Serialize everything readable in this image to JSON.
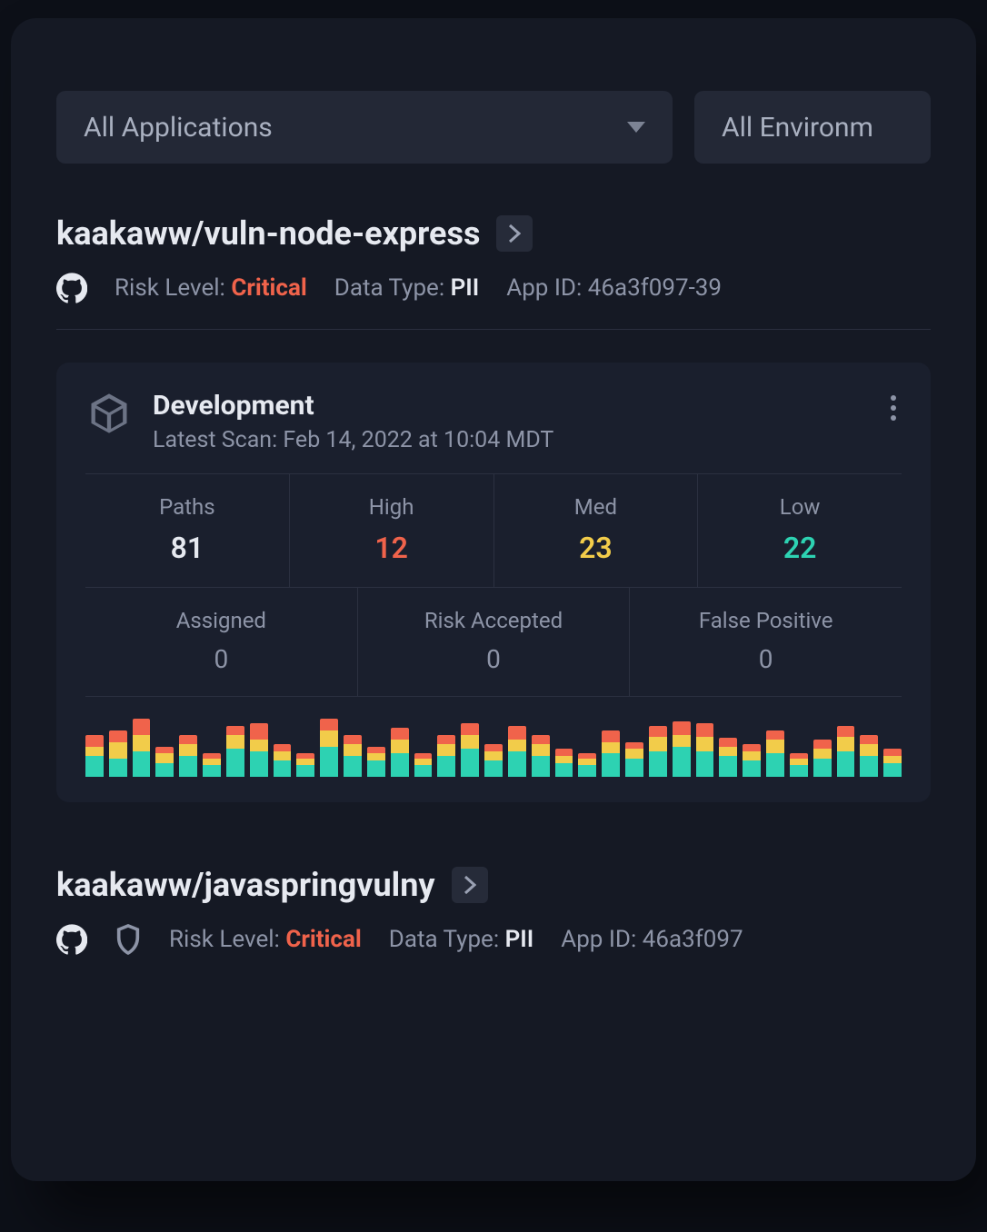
{
  "filters": {
    "applications_label": "All Applications",
    "environments_label": "All Environm"
  },
  "apps": [
    {
      "name": "kaakaww/vuln-node-express",
      "risk_label": "Risk Level:",
      "risk_value": "Critical",
      "data_label": "Data Type:",
      "data_value": "PII",
      "appid_label": "App ID:",
      "appid_value": "46a3f097-39",
      "env": {
        "name": "Development",
        "scan_label": "Latest Scan: Feb 14, 2022 at 10:04 MDT",
        "stats": {
          "paths_label": "Paths",
          "paths": "81",
          "high_label": "High",
          "high": "12",
          "med_label": "Med",
          "med": "23",
          "low_label": "Low",
          "low": "22",
          "assigned_label": "Assigned",
          "assigned": "0",
          "risk_accepted_label": "Risk Accepted",
          "risk_accepted": "0",
          "false_positive_label": "False Positive",
          "false_positive": "0"
        }
      }
    },
    {
      "name": "kaakaww/javaspringvulny",
      "risk_label": "Risk Level:",
      "risk_value": "Critical",
      "data_label": "Data Type:",
      "data_value": "PII",
      "appid_label": "App ID:",
      "appid_value": "46a3f097"
    }
  ],
  "colors": {
    "critical": "#f0634b",
    "high": "#f0634b",
    "med": "#f2cc4a",
    "low": "#2dd2b2"
  },
  "chart_data": {
    "type": "bar",
    "title": "",
    "xlabel": "",
    "ylabel": "",
    "series_names": [
      "low",
      "med",
      "high"
    ],
    "bars": [
      {
        "low": 18,
        "med": 8,
        "high": 10
      },
      {
        "low": 16,
        "med": 14,
        "high": 10
      },
      {
        "low": 22,
        "med": 14,
        "high": 14
      },
      {
        "low": 12,
        "med": 8,
        "high": 6
      },
      {
        "low": 18,
        "med": 10,
        "high": 8
      },
      {
        "low": 10,
        "med": 6,
        "high": 4
      },
      {
        "low": 24,
        "med": 12,
        "high": 8
      },
      {
        "low": 22,
        "med": 10,
        "high": 14
      },
      {
        "low": 14,
        "med": 8,
        "high": 6
      },
      {
        "low": 10,
        "med": 6,
        "high": 4
      },
      {
        "low": 26,
        "med": 14,
        "high": 10
      },
      {
        "low": 18,
        "med": 10,
        "high": 8
      },
      {
        "low": 14,
        "med": 6,
        "high": 6
      },
      {
        "low": 20,
        "med": 12,
        "high": 10
      },
      {
        "low": 10,
        "med": 6,
        "high": 4
      },
      {
        "low": 18,
        "med": 10,
        "high": 8
      },
      {
        "low": 24,
        "med": 12,
        "high": 10
      },
      {
        "low": 14,
        "med": 8,
        "high": 6
      },
      {
        "low": 22,
        "med": 10,
        "high": 12
      },
      {
        "low": 18,
        "med": 10,
        "high": 8
      },
      {
        "low": 12,
        "med": 6,
        "high": 6
      },
      {
        "low": 10,
        "med": 6,
        "high": 4
      },
      {
        "low": 20,
        "med": 10,
        "high": 10
      },
      {
        "low": 16,
        "med": 8,
        "high": 6
      },
      {
        "low": 22,
        "med": 12,
        "high": 10
      },
      {
        "low": 26,
        "med": 10,
        "high": 12
      },
      {
        "low": 22,
        "med": 12,
        "high": 12
      },
      {
        "low": 18,
        "med": 8,
        "high": 8
      },
      {
        "low": 14,
        "med": 8,
        "high": 6
      },
      {
        "low": 20,
        "med": 12,
        "high": 8
      },
      {
        "low": 10,
        "med": 6,
        "high": 4
      },
      {
        "low": 16,
        "med": 8,
        "high": 8
      },
      {
        "low": 22,
        "med": 12,
        "high": 10
      },
      {
        "low": 18,
        "med": 10,
        "high": 8
      },
      {
        "low": 12,
        "med": 6,
        "high": 6
      }
    ]
  }
}
